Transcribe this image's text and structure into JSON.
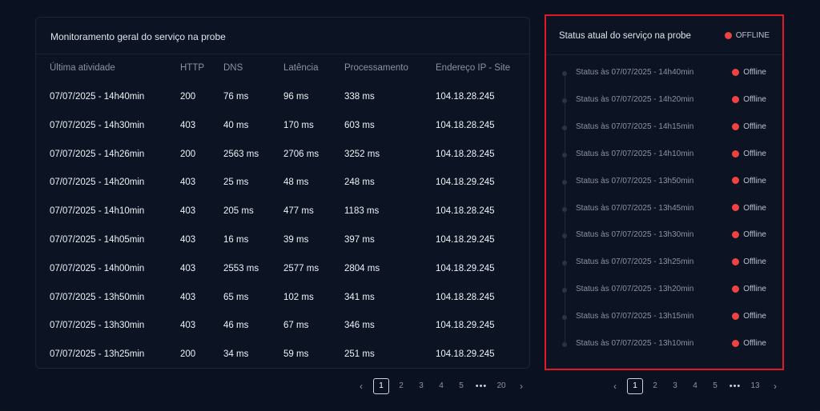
{
  "general": {
    "title": "Monitoramento geral do serviço na probe",
    "columns": [
      "Última atividade",
      "HTTP",
      "DNS",
      "Latência",
      "Processamento",
      "Endereço IP - Site"
    ],
    "rows": [
      [
        "07/07/2025 - 14h40min",
        "200",
        "76 ms",
        "96 ms",
        "338 ms",
        "104.18.28.245"
      ],
      [
        "07/07/2025 - 14h30min",
        "403",
        "40 ms",
        "170 ms",
        "603 ms",
        "104.18.28.245"
      ],
      [
        "07/07/2025 - 14h26min",
        "200",
        "2563 ms",
        "2706 ms",
        "3252 ms",
        "104.18.28.245"
      ],
      [
        "07/07/2025 - 14h20min",
        "403",
        "25 ms",
        "48 ms",
        "248 ms",
        "104.18.29.245"
      ],
      [
        "07/07/2025 - 14h10min",
        "403",
        "205 ms",
        "477 ms",
        "1183 ms",
        "104.18.28.245"
      ],
      [
        "07/07/2025 - 14h05min",
        "403",
        "16 ms",
        "39 ms",
        "397 ms",
        "104.18.29.245"
      ],
      [
        "07/07/2025 - 14h00min",
        "403",
        "2553 ms",
        "2577 ms",
        "2804 ms",
        "104.18.29.245"
      ],
      [
        "07/07/2025 - 13h50min",
        "403",
        "65 ms",
        "102 ms",
        "341 ms",
        "104.18.28.245"
      ],
      [
        "07/07/2025 - 13h30min",
        "403",
        "46 ms",
        "67 ms",
        "346 ms",
        "104.18.29.245"
      ],
      [
        "07/07/2025 - 13h25min",
        "200",
        "34 ms",
        "59 ms",
        "251 ms",
        "104.18.29.245"
      ]
    ],
    "pagination": {
      "prev_icon": "chevron-left-icon",
      "pages": [
        "1",
        "2",
        "3",
        "4",
        "5"
      ],
      "ellipsis": "•••",
      "last": "20",
      "next_icon": "chevron-right-icon",
      "current": "1"
    }
  },
  "status": {
    "title": "Status atual do serviço na probe",
    "current": "OFFLINE",
    "status_color": "#f04242",
    "items": [
      {
        "label": "Status às 07/07/2025 - 14h40min",
        "state": "Offline"
      },
      {
        "label": "Status às 07/07/2025 - 14h20min",
        "state": "Offline"
      },
      {
        "label": "Status às 07/07/2025 - 14h15min",
        "state": "Offline"
      },
      {
        "label": "Status às 07/07/2025 - 14h10min",
        "state": "Offline"
      },
      {
        "label": "Status às 07/07/2025 - 13h50min",
        "state": "Offline"
      },
      {
        "label": "Status às 07/07/2025 - 13h45min",
        "state": "Offline"
      },
      {
        "label": "Status às 07/07/2025 - 13h30min",
        "state": "Offline"
      },
      {
        "label": "Status às 07/07/2025 - 13h25min",
        "state": "Offline"
      },
      {
        "label": "Status às 07/07/2025 - 13h20min",
        "state": "Offline"
      },
      {
        "label": "Status às 07/07/2025 - 13h15min",
        "state": "Offline"
      },
      {
        "label": "Status às 07/07/2025 - 13h10min",
        "state": "Offline"
      }
    ],
    "pagination": {
      "prev_icon": "chevron-left-icon",
      "pages": [
        "1",
        "2",
        "3",
        "4",
        "5"
      ],
      "ellipsis": "•••",
      "last": "13",
      "next_icon": "chevron-right-icon",
      "current": "1"
    }
  }
}
